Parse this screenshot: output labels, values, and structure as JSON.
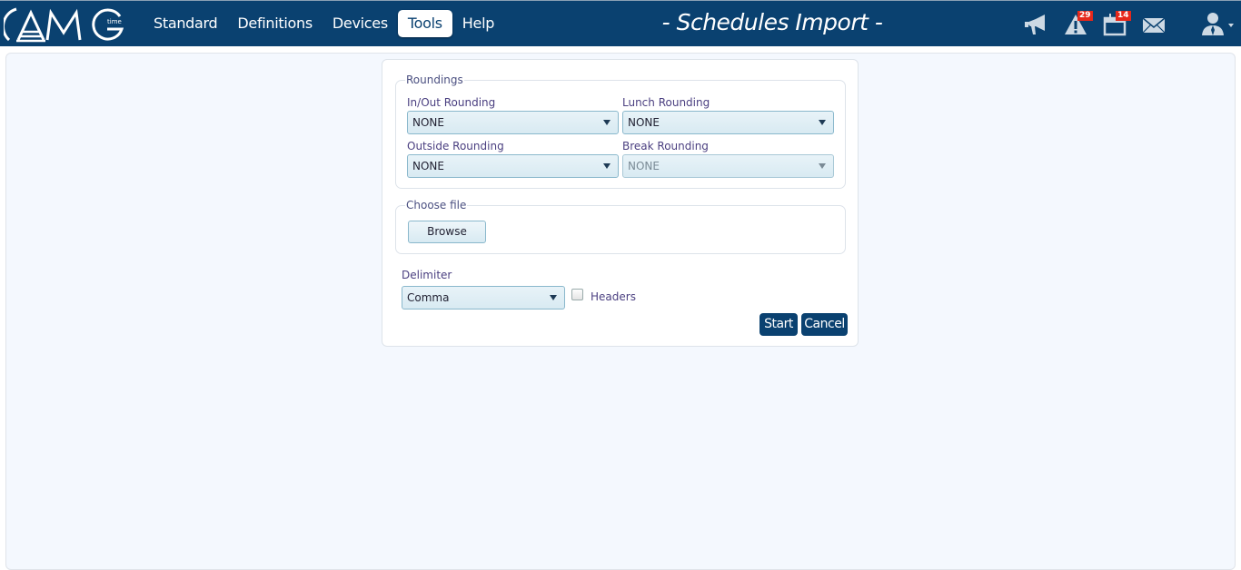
{
  "header": {
    "logo_text": "AMG",
    "logo_subtext": "time",
    "nav": [
      {
        "label": "Standard",
        "active": false
      },
      {
        "label": "Definitions",
        "active": false
      },
      {
        "label": "Devices",
        "active": false
      },
      {
        "label": "Tools",
        "active": true
      },
      {
        "label": "Help",
        "active": false
      }
    ],
    "title": "- Schedules Import -",
    "icons": [
      {
        "name": "megaphone-icon",
        "badge": null
      },
      {
        "name": "alert-icon",
        "badge": "29"
      },
      {
        "name": "calendar-icon",
        "badge": "14"
      },
      {
        "name": "mail-icon",
        "badge": null
      },
      {
        "name": "user-icon",
        "badge": null
      }
    ],
    "badges": {
      "alerts": "29",
      "calendar": "14"
    }
  },
  "roundings": {
    "legend": "Roundings",
    "in_out": {
      "label": "In/Out Rounding",
      "value": "NONE"
    },
    "lunch": {
      "label": "Lunch Rounding",
      "value": "NONE"
    },
    "outside": {
      "label": "Outside Rounding",
      "value": "NONE"
    },
    "break": {
      "label": "Break Rounding",
      "value": "NONE",
      "disabled": true
    }
  },
  "file": {
    "legend": "Choose file",
    "browse_label": "Browse"
  },
  "delimiter": {
    "label": "Delimiter",
    "value": "Comma",
    "headers_label": "Headers",
    "headers_checked": false
  },
  "actions": {
    "start_label": "Start",
    "cancel_label": "Cancel"
  },
  "colors": {
    "header_bg": "#0a4170",
    "badge": "#e5281b",
    "content_bg": "#f4f8fe"
  }
}
